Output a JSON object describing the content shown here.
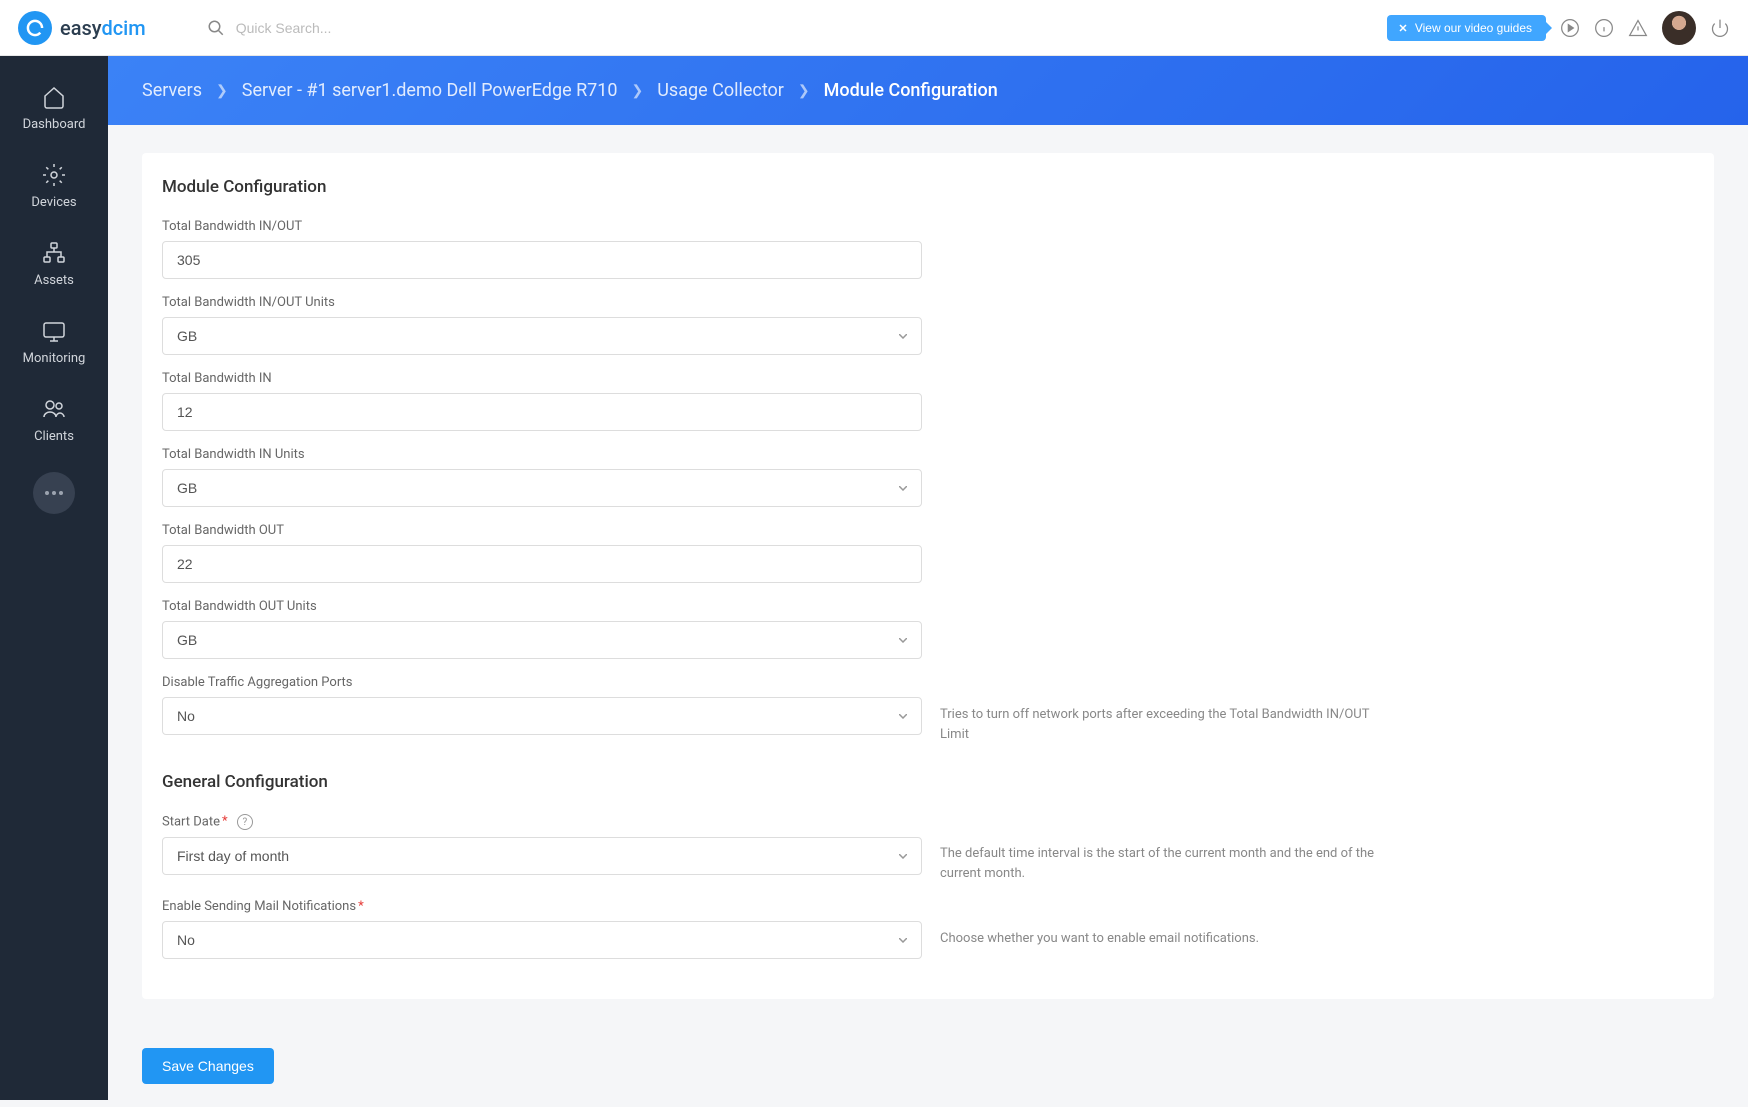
{
  "header": {
    "logo_easy": "easy",
    "logo_dcim": "dcim",
    "search_placeholder": "Quick Search...",
    "video_guide_label": "View our video guides"
  },
  "sidebar": {
    "items": [
      {
        "label": "Dashboard"
      },
      {
        "label": "Devices"
      },
      {
        "label": "Assets"
      },
      {
        "label": "Monitoring"
      },
      {
        "label": "Clients"
      }
    ]
  },
  "breadcrumb": {
    "items": [
      "Servers",
      "Server - #1 server1.demo Dell PowerEdge R710",
      "Usage Collector",
      "Module Configuration"
    ]
  },
  "form": {
    "module_section_title": "Module Configuration",
    "general_section_title": "General Configuration",
    "fields": {
      "total_bw_inout": {
        "label": "Total Bandwidth IN/OUT",
        "value": "305"
      },
      "total_bw_inout_units": {
        "label": "Total Bandwidth IN/OUT Units",
        "value": "GB"
      },
      "total_bw_in": {
        "label": "Total Bandwidth IN",
        "value": "12"
      },
      "total_bw_in_units": {
        "label": "Total Bandwidth IN Units",
        "value": "GB"
      },
      "total_bw_out": {
        "label": "Total Bandwidth OUT",
        "value": "22"
      },
      "total_bw_out_units": {
        "label": "Total Bandwidth OUT Units",
        "value": "GB"
      },
      "disable_traffic_agg": {
        "label": "Disable Traffic Aggregation Ports",
        "value": "No",
        "hint": "Tries to turn off network ports after exceeding the Total Bandwidth IN/OUT Limit"
      },
      "start_date": {
        "label": "Start Date",
        "value": "First day of month",
        "hint": "The default time interval is the start of the current month and the end of the current month."
      },
      "enable_mail": {
        "label": "Enable Sending Mail Notifications",
        "value": "No",
        "hint": "Choose whether you want to enable email notifications."
      }
    },
    "save_label": "Save Changes"
  }
}
